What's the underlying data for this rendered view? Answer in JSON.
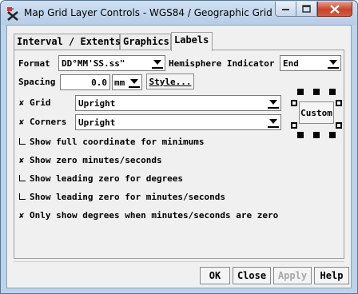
{
  "window": {
    "title": "Map Grid Layer Controls - WGS84 / Geographic Grid"
  },
  "tabs": [
    {
      "label": "Interval / Extents"
    },
    {
      "label": "Graphics"
    },
    {
      "label": "Labels"
    }
  ],
  "labels_tab": {
    "format_label": "Format",
    "format_value": "DD°MM'SS.ss\"",
    "hemisphere_label": "Hemisphere Indicator",
    "hemisphere_value": "End",
    "spacing_label": "Spacing",
    "spacing_value": "0.0",
    "spacing_unit": "mm",
    "style_button": "Style...",
    "grid_label": "Grid",
    "grid_checked": true,
    "grid_value": "Upright",
    "corners_label": "Corners",
    "corners_checked": true,
    "corners_value": "Upright",
    "custom_button": "Custom",
    "options": [
      {
        "label": "Show full coordinate for minimums",
        "checked": false
      },
      {
        "label": "Show zero minutes/seconds",
        "checked": true
      },
      {
        "label": "Show leading zero for degrees",
        "checked": false
      },
      {
        "label": "Show leading zero for minutes/seconds",
        "checked": false
      },
      {
        "label": "Only show degrees when minutes/seconds are zero",
        "checked": true
      }
    ]
  },
  "footer": {
    "ok": "OK",
    "close": "Close",
    "apply": "Apply",
    "help": "Help"
  },
  "colors": {
    "title_bar": "#bcd3ea",
    "close_button": "#c8442c",
    "disabled_text": "#a7a7a7"
  }
}
